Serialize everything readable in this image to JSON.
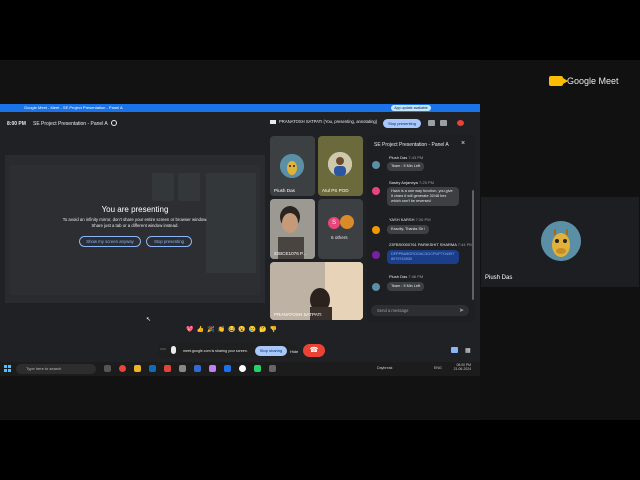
{
  "outer": {
    "brand": "Google Meet",
    "participant_name": "Piush Das"
  },
  "browser": {
    "tab_title": "Google Meet - Meet - SE Project Presentation - Panel A",
    "update_label": "App update available"
  },
  "meeting": {
    "time": "8:00 PM",
    "title": "SE Project Presentation - Panel A",
    "presenter_status": "PRANATOSH SATPATI (You, presenting, annotating)",
    "stop_presenting_label": "Stop presenting"
  },
  "presenting": {
    "heading": "You are presenting",
    "note_line1": "To avoid an infinity mirror, don't share your entire screen or browser window.",
    "note_line2": "Share just a tab or a different window instead.",
    "show_anyway_label": "Show my screen anyway",
    "stop_label": "Stop presenting"
  },
  "tiles": [
    {
      "name": "Piush Das"
    },
    {
      "name": "Atul PS POD"
    },
    {
      "name": "22BCE1076 P..."
    },
    {
      "name": "6 others",
      "badge": "S"
    },
    {
      "name": "PRANATOSH SATPATI"
    }
  ],
  "chat": {
    "title": "SE Project Presentation - Panel A",
    "messages": [
      {
        "author": "Piush Das",
        "time": "7:43 PM",
        "text": "",
        "color": "#5a8fa6"
      },
      {
        "author": "",
        "time": "",
        "text": "Team : 5 Min Left",
        "color": "#5a8fa6"
      },
      {
        "author": "Sastry Anjaneya",
        "time": "7:25 PM",
        "text": "Hash is a one way function, you give it chars it will generate 32/48 hex which can't be reversed",
        "color": "#e8457a"
      },
      {
        "author": "YASH KARSH",
        "time": "7:26 PM",
        "text": "Exactly. Thanks Sir !",
        "color": "#f29900"
      },
      {
        "author": "23FBS0000761 PARIKSHIT SHARMA",
        "time": "7:44 PM",
        "text": "DFPPBA8GROGAC3GCPUP7O4397 8979743930",
        "color": "#7b1fa2"
      },
      {
        "author": "Piush Das",
        "time": "7:46 PM",
        "text": "Team : 5 Min Left",
        "color": "#5a8fa6"
      }
    ],
    "input_placeholder": "Send a message"
  },
  "controls": {
    "reactions": [
      "💖",
      "👍",
      "🎉",
      "👏",
      "😂",
      "😮",
      "😢",
      "🤔",
      "👎"
    ],
    "share_text": "meet.google.com is sharing your screen.",
    "stop_sharing_label": "Stop sharing",
    "hide_label": "Hide"
  },
  "taskbar": {
    "search_placeholder": "Type here to search",
    "weather": "Daybreak",
    "lang": "ENG",
    "time": "08:00 PM",
    "date": "21-06-2024"
  }
}
